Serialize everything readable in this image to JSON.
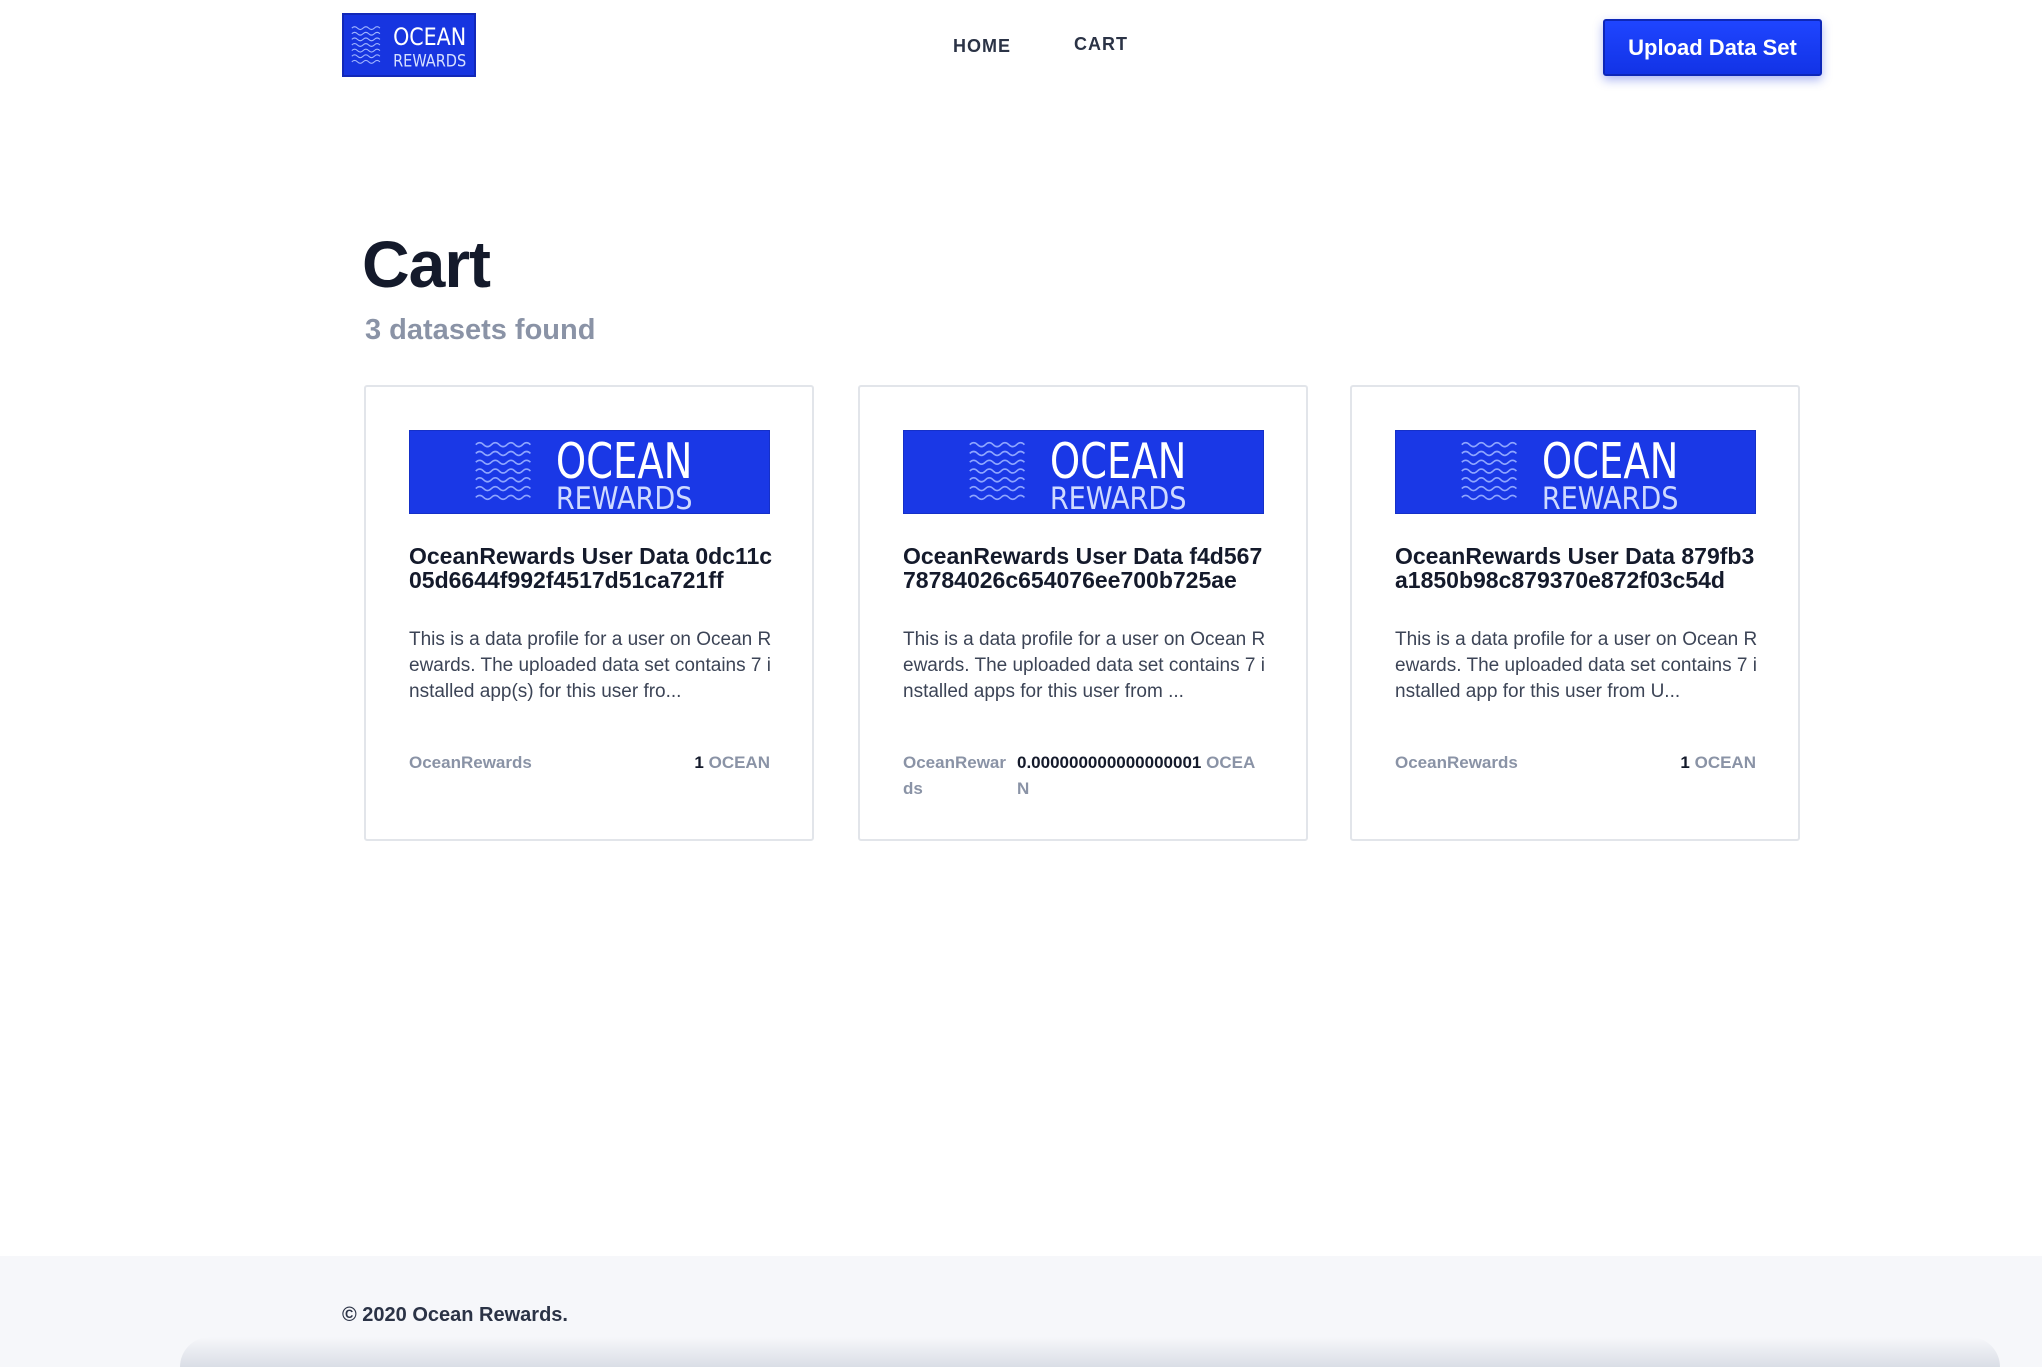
{
  "header": {
    "logo": {
      "line1": "OCEAN",
      "line2": "REWARDS",
      "color": "#1735e0"
    },
    "nav": [
      {
        "label": "HOME"
      },
      {
        "label": "CART"
      }
    ],
    "upload_button_label": "Upload Data Set"
  },
  "main": {
    "title": "Cart",
    "subtitle": "3 datasets found",
    "cards": [
      {
        "image": {
          "line1": "OCEAN",
          "line2": "REWARDS"
        },
        "title": "OceanRewards User Data 0dc11c05d6644f992f4517d51ca721ff",
        "description": "This is a data profile for a user on Ocean Rewards. The uploaded data set contains 7 installed app(s) for this user fro...",
        "publisher": "OceanRewards",
        "price_amount": "1",
        "price_currency": "OCEAN"
      },
      {
        "image": {
          "line1": "OCEAN",
          "line2": "REWARDS"
        },
        "title": "OceanRewards User Data f4d56778784026c654076ee700b725ae",
        "description": "This is a data profile for a user on Ocean Rewards. The uploaded data set contains 7 installed apps for this user from ...",
        "publisher": "OceanRewards",
        "price_amount": "0.000000000000000001",
        "price_currency": "OCEAN"
      },
      {
        "image": {
          "line1": "OCEAN",
          "line2": "REWARDS"
        },
        "title": "OceanRewards User Data 879fb3a1850b98c879370e872f03c54d",
        "description": "This is a data profile for a user on Ocean Rewards. The uploaded data set contains 7 installed app for this user from U...",
        "publisher": "OceanRewards",
        "price_amount": "1",
        "price_currency": "OCEAN"
      }
    ]
  },
  "footer": {
    "copyright": "© 2020 Ocean Rewards."
  },
  "colors": {
    "brand_blue": "#1a38e6",
    "text_dark": "#141a2b",
    "text_muted": "#8a93a6"
  }
}
